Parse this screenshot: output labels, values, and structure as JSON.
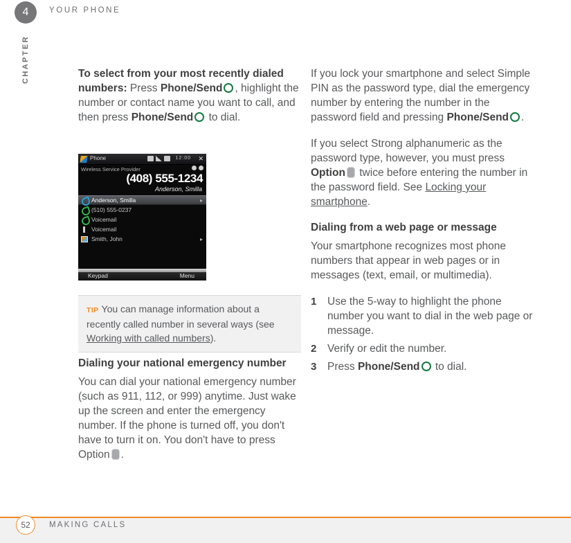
{
  "header": {
    "chapter_number": "4",
    "title": "YOUR PHONE",
    "chapter_word": "CHAPTER"
  },
  "left_column": {
    "para1": {
      "lead": "To select from your most recently dialed numbers:",
      "t1": " Press ",
      "b1": "Phone/Send",
      "t2": ", highlight the number or contact name you want to call, and then press ",
      "b2": "Phone/Send",
      "t3": " to dial."
    },
    "tip": {
      "label": "TIP",
      "text1": "You can manage information about a recently called number in several ways (see ",
      "link": "Working with called numbers",
      "text2": ")."
    },
    "heading_emergency": "Dialing your national emergency number",
    "para_emergency": {
      "t1": "You can dial your national emergency number (such as 911, 112, or 999) anytime. Just wake up the screen and enter the emergency number. If the phone is turned off, you don't have to turn it on. You don't have to press Option",
      "t2": "."
    }
  },
  "phone_screenshot": {
    "title": "Phone",
    "clock": "12:00",
    "close_glyph": "✕",
    "carrier": "Wireless Service Provider",
    "number": "(408) 555-1234",
    "caller_name": "Anderson, Smilla",
    "list": [
      {
        "icon": "phone-in-icon",
        "label": "Anderson, Smilla",
        "right": "▸",
        "selected": true
      },
      {
        "icon": "phone-out-icon",
        "label": "(510) 555-0237",
        "right": "",
        "selected": false
      },
      {
        "icon": "phone-out-icon",
        "label": "Voicemail",
        "right": "",
        "selected": false
      },
      {
        "icon": "voicemail-icon",
        "label": "Voicemail",
        "right": "",
        "selected": false
      },
      {
        "icon": "contact-card-icon",
        "label": "Smith, John",
        "right": "▸",
        "selected": false
      }
    ],
    "softkey_left": "Keypad",
    "softkey_right": "Menu"
  },
  "right_column": {
    "para1": {
      "t1": "If you lock your smartphone and select Simple PIN as the password type, dial the emergency number by entering the number in the password field and pressing ",
      "b1": "Phone/Send",
      "t2": "."
    },
    "para2": {
      "t1": "If you select Strong alphanumeric as the password type, however, you must press ",
      "b1": "Option",
      "t2": " twice before entering the number in the password field. See ",
      "link": "Locking your smartphone",
      "t3": "."
    },
    "heading_webpage": "Dialing from a web page or message",
    "para3": "Your smartphone recognizes most phone numbers that appear in web pages or in messages (text, email, or multimedia).",
    "steps": [
      {
        "num": "1",
        "text": "Use the 5-way to highlight the phone number you want to dial in the web page or message."
      },
      {
        "num": "2",
        "text": "Verify or edit the number."
      },
      {
        "num": "3",
        "pre": "Press ",
        "bold": "Phone/Send",
        "post": " to dial."
      }
    ]
  },
  "footer": {
    "page_number": "52",
    "title": "MAKING CALLS"
  },
  "colors": {
    "accent_orange": "#f08a24",
    "send_green": "#127b3e",
    "badge_gray": "#77777a",
    "text_gray": "#58595b"
  }
}
